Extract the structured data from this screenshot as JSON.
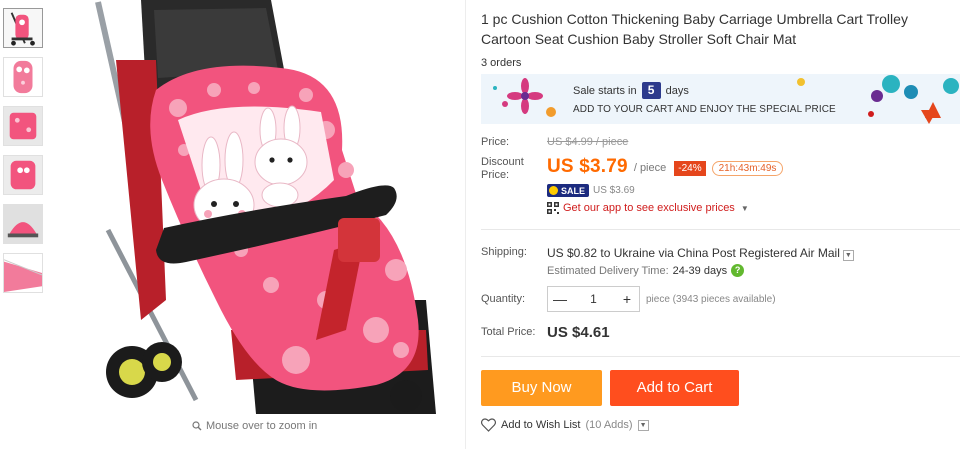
{
  "product": {
    "title": "1 pc Cushion Cotton Thickening Baby Carriage Umbrella Cart Trolley Cartoon Seat Cushion Baby Stroller Soft Chair Mat",
    "orders": "3 orders"
  },
  "gallery": {
    "zoom_hint": "Mouse over to zoom in",
    "thumb_count": 6
  },
  "sale_banner": {
    "starts_prefix": "Sale starts in",
    "days_number": "5",
    "days_suffix": "days",
    "subtitle": "ADD TO YOUR CART AND ENJOY THE SPECIAL PRICE"
  },
  "price": {
    "label": "Price:",
    "old_price": "US $4.99 / piece",
    "discount_label": "Discount Price:",
    "current_price": "US $3.79",
    "per_piece": "/ piece",
    "discount_badge": "-24%",
    "timer": "21h:43m:49s",
    "sale_tag": "SALE",
    "sale_price": "US $3.69",
    "app_promo": "Get our app to see exclusive prices"
  },
  "shipping": {
    "label": "Shipping:",
    "cost": "US $0.82",
    "to_word": "to",
    "destination": "Ukraine",
    "via_text": "via China Post Registered Air Mail",
    "eta_label": "Estimated Delivery Time:",
    "eta_value": "24-39 days"
  },
  "quantity": {
    "label": "Quantity:",
    "value": "1",
    "minus": "—",
    "plus": "+",
    "note": "piece (3943 pieces available)"
  },
  "total": {
    "label": "Total Price:",
    "value": "US $4.61"
  },
  "actions": {
    "buy_now": "Buy Now",
    "add_to_cart": "Add to Cart",
    "wish_list": "Add to Wish List",
    "wish_count": "(10 Adds)"
  },
  "colors": {
    "accent_orange": "#ff6a00",
    "buy_now_bg": "#ff9a1f",
    "add_cart_bg": "#ff4e1e",
    "promo_red": "#d01c1c",
    "cushion_pink": "#f2547e"
  }
}
